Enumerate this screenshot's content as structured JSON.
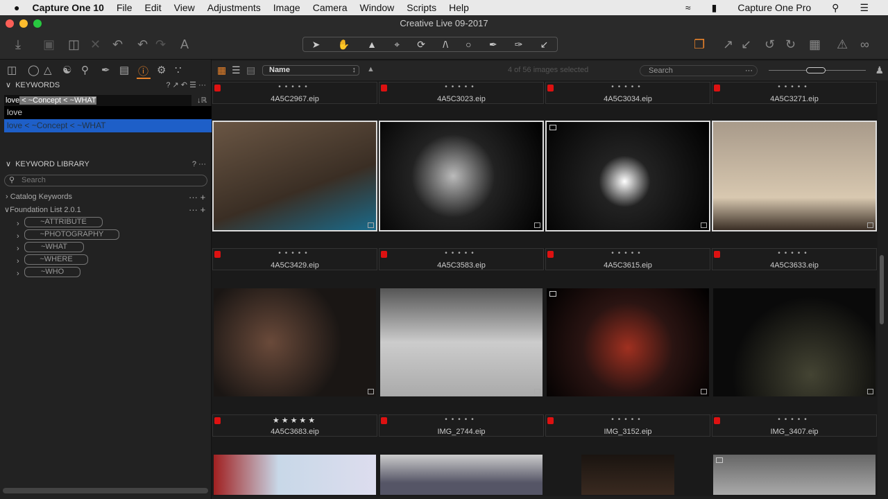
{
  "menubar": {
    "apple": "",
    "app": "Capture One 10",
    "items": [
      "File",
      "Edit",
      "View",
      "Adjustments",
      "Image",
      "Camera",
      "Window",
      "Scripts",
      "Help"
    ],
    "right_app": "Capture One Pro"
  },
  "window": {
    "title": "Creative Live 09-2017"
  },
  "keywords": {
    "title": "KEYWORDS",
    "input_typed": "love",
    "input_completion": " < ~Concept < ~WHAT",
    "suggestions": [
      "love",
      "love < ~Concept < ~WHAT"
    ],
    "selected_suggestion": 1
  },
  "library": {
    "title": "KEYWORD LIBRARY",
    "search_placeholder": "Search",
    "catalog": "Catalog Keywords",
    "foundation": "Foundation List 2.0.1",
    "groups": [
      "~ATTRIBUTE",
      "~PHOTOGRAPHY",
      "~WHAT",
      "~WHERE",
      "~WHO"
    ]
  },
  "browser": {
    "sort": "Name",
    "selection": "4 of 56 images selected",
    "search_placeholder": "Search"
  },
  "accent": "#e8822a",
  "tag_color": "#dd1111",
  "rows": [
    [
      {
        "name": "4A5C2967.eip",
        "rating": 0
      },
      {
        "name": "4A5C3023.eip",
        "rating": 0
      },
      {
        "name": "4A5C3034.eip",
        "rating": 0
      },
      {
        "name": "4A5C3271.eip",
        "rating": 0
      }
    ],
    [
      {
        "name": "4A5C3429.eip",
        "rating": 0
      },
      {
        "name": "4A5C3583.eip",
        "rating": 0
      },
      {
        "name": "4A5C3615.eip",
        "rating": 0
      },
      {
        "name": "4A5C3633.eip",
        "rating": 0
      }
    ],
    [
      {
        "name": "4A5C3683.eip",
        "rating": 5
      },
      {
        "name": "IMG_2744.eip",
        "rating": 0
      },
      {
        "name": "IMG_3152.eip",
        "rating": 0
      },
      {
        "name": "IMG_3407.eip",
        "rating": 0
      }
    ]
  ]
}
